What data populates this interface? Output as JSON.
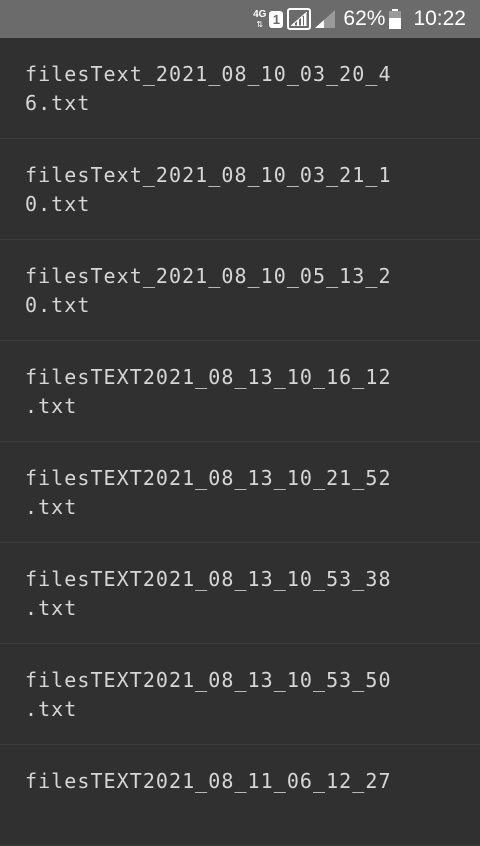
{
  "status_bar": {
    "network_type": "4G",
    "sim_slot": "1",
    "battery_percent": "62%",
    "time": "10:22"
  },
  "files": [
    {
      "line1": "filesText_2021_08_10_03_20_4",
      "line2": "6.txt"
    },
    {
      "line1": "filesText_2021_08_10_03_21_1",
      "line2": "0.txt"
    },
    {
      "line1": "filesText_2021_08_10_05_13_2",
      "line2": "0.txt"
    },
    {
      "line1": "filesTEXT2021_08_13_10_16_12",
      "line2": ".txt"
    },
    {
      "line1": "filesTEXT2021_08_13_10_21_52",
      "line2": ".txt"
    },
    {
      "line1": "filesTEXT2021_08_13_10_53_38",
      "line2": ".txt"
    },
    {
      "line1": "filesTEXT2021_08_13_10_53_50",
      "line2": ".txt"
    },
    {
      "line1": "filesTEXT2021_08_11_06_12_27",
      "line2": ""
    }
  ]
}
